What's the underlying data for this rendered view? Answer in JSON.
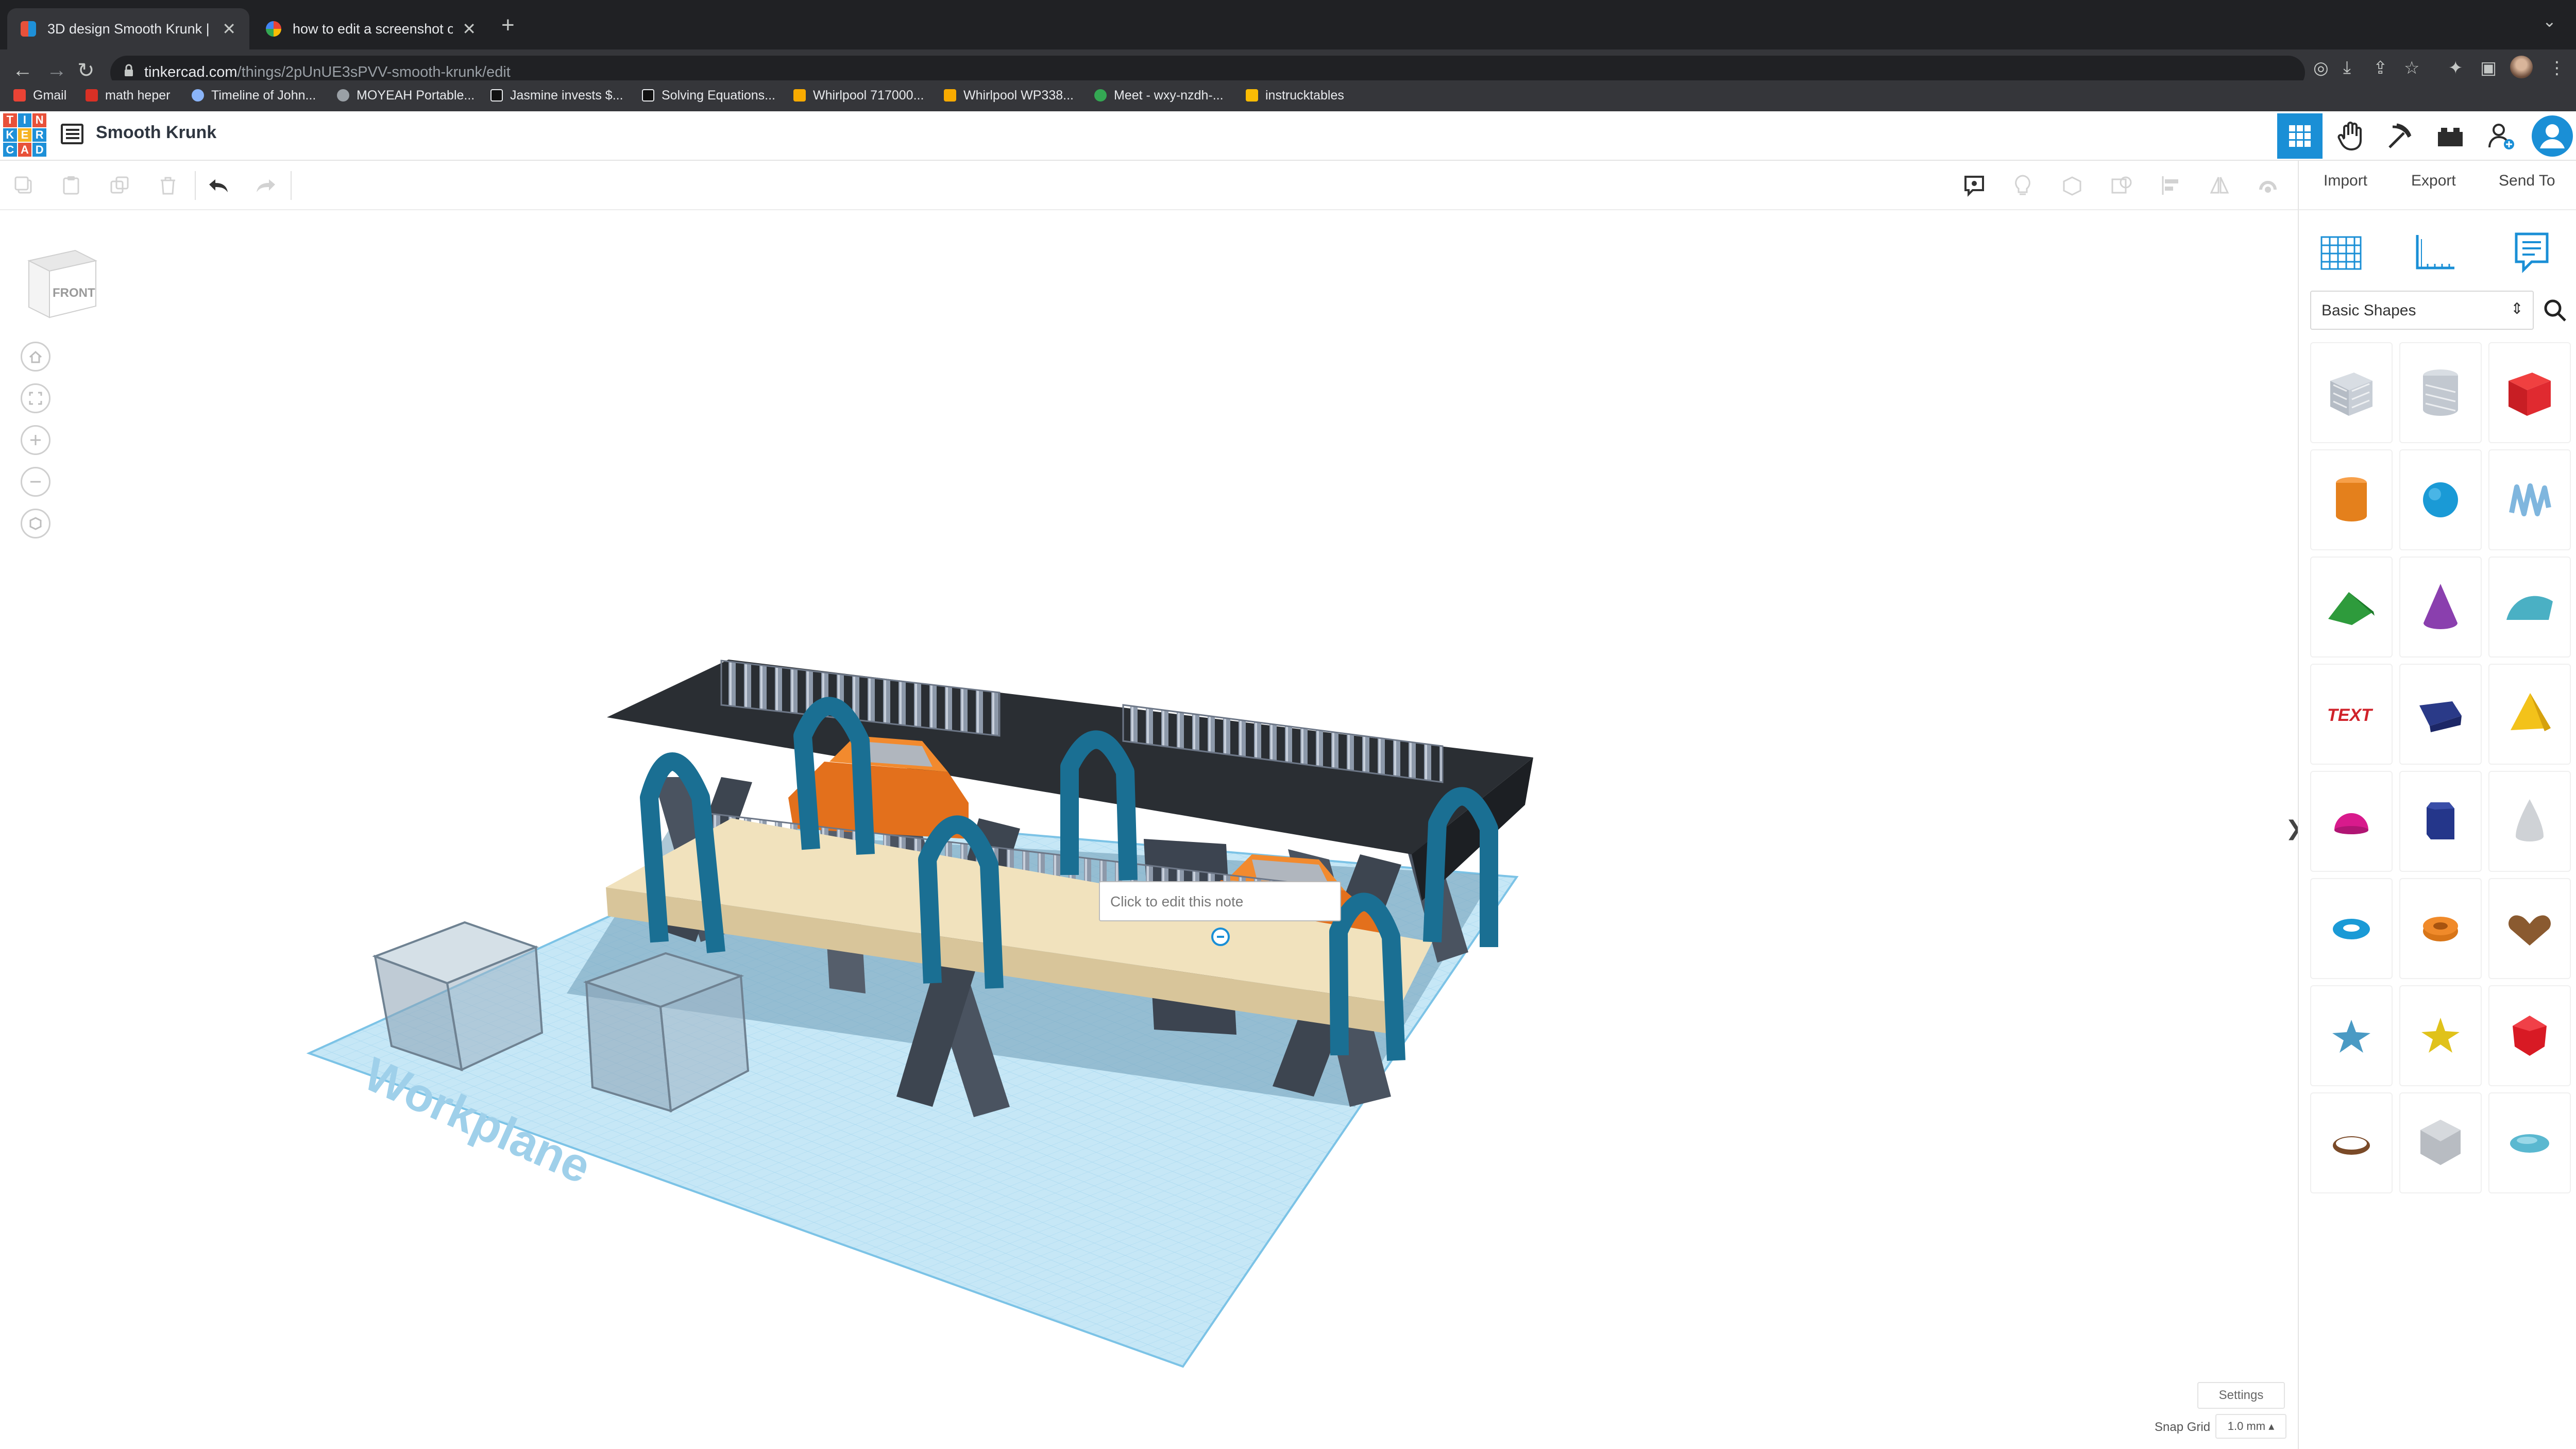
{
  "browser": {
    "tabs": [
      {
        "title": "3D design Smooth Krunk | Tinl",
        "active": true,
        "favicon_color": "#e8513a"
      },
      {
        "title": "how to edit a screenshot on m",
        "active": false,
        "favicon_color": "#4285f4"
      }
    ],
    "new_tab": "+",
    "url_host": "tinkercad.com",
    "url_path": "/things/2pUnUE3sPVV-smooth-krunk/edit",
    "bookmarks": [
      {
        "label": "Gmail",
        "color": "#ea4335"
      },
      {
        "label": "math heper",
        "color": "#d93025"
      },
      {
        "label": "Timeline of John...",
        "color": "#8ab4f8"
      },
      {
        "label": "MOYEAH Portable...",
        "color": "#9aa0a6"
      },
      {
        "label": "Jasmine invests $...",
        "color": "#202124"
      },
      {
        "label": "Solving Equations...",
        "color": "#202124"
      },
      {
        "label": "Whirlpool 717000...",
        "color": "#f9ab00"
      },
      {
        "label": "Whirlpool WP338...",
        "color": "#f9ab00"
      },
      {
        "label": "Meet - wxy-nzdh-...",
        "color": "#34a853"
      },
      {
        "label": "instrucktables",
        "color": "#fbbc04"
      }
    ]
  },
  "app": {
    "logo_letters": [
      "T",
      "I",
      "N",
      "K",
      "E",
      "R",
      "C",
      "A",
      "D"
    ],
    "logo_colors": [
      "#e8513a",
      "#1e90d8",
      "#e8513a",
      "#1e90d8",
      "#f6b322",
      "#1e90d8",
      "#1e90d8",
      "#e8513a",
      "#1e90d8"
    ],
    "design_name": "Smooth Krunk",
    "accent": "#1a8fd6"
  },
  "panel": {
    "import_label": "Import",
    "export_label": "Export",
    "sendto_label": "Send To",
    "shape_category": "Basic Shapes",
    "shapes": [
      "box-hole",
      "cylinder-hole",
      "box",
      "cylinder",
      "sphere",
      "scribble",
      "roof",
      "cone",
      "round-roof",
      "text",
      "wedge",
      "pyramid",
      "half-sphere",
      "polygon",
      "paraboloid",
      "torus",
      "tube",
      "heart",
      "star",
      "star-gold",
      "icosahedron",
      "ring",
      "octahedron-grey",
      "capsule"
    ]
  },
  "viewport": {
    "viewcube_label": "FRONT",
    "workplane_label": "Workplane",
    "note_placeholder": "Click to edit this note",
    "settings_label": "Settings",
    "snap_grid_label": "Snap Grid",
    "snap_grid_value": "1.0 mm ▴"
  },
  "collapse_arrow": "❯"
}
